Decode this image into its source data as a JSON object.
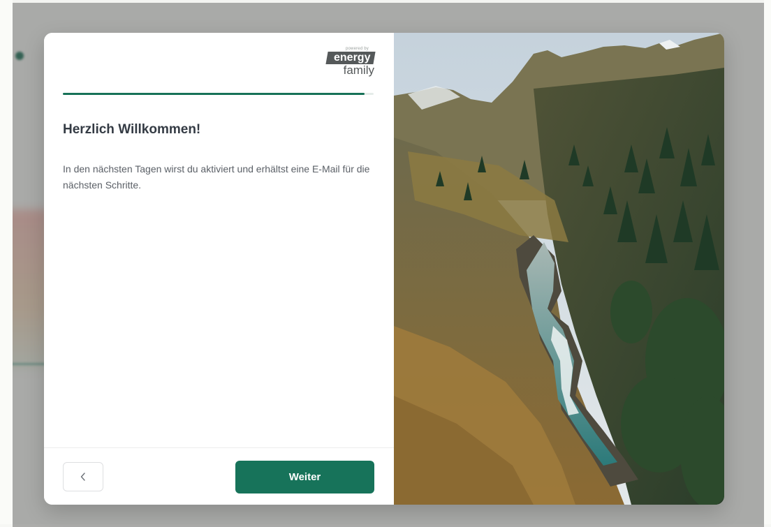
{
  "logo": {
    "powered_by": "powered by",
    "brand_top": "energy",
    "brand_bottom": "family"
  },
  "progress": {
    "fraction": 0.97
  },
  "welcome": {
    "title": "Herzlich Willkommen!",
    "body": "In den nächsten Tagen wirst du aktiviert und erhältst eine E-Mail für die nächsten Schritte."
  },
  "footer": {
    "back_icon": "chevron-left-icon",
    "next_label": "Weiter"
  },
  "colors": {
    "accent": "#17735a",
    "title": "#343b44",
    "text": "#5a5f66"
  }
}
